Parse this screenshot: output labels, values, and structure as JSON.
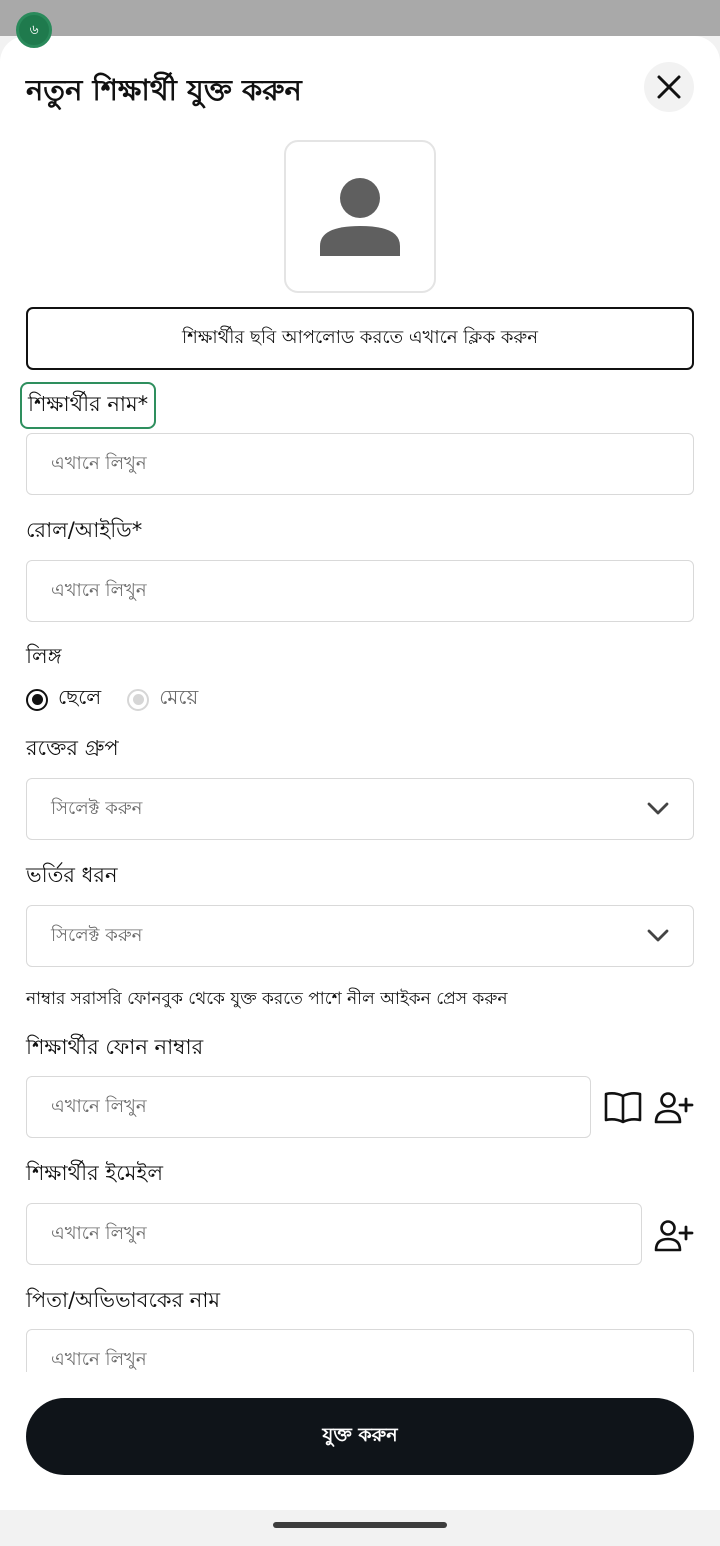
{
  "status_badge": "৬",
  "sheet": {
    "title": "নতুন শিক্ষার্থী যুক্ত করুন",
    "upload_label": "শিক্ষার্থীর ছবি আপলোড করতে এখানে ক্লিক করুন"
  },
  "form": {
    "name": {
      "label": "শিক্ষার্থীর নাম*",
      "placeholder": "এখানে লিখুন"
    },
    "roll": {
      "label": "রোল/আইডি*",
      "placeholder": "এখানে লিখুন"
    },
    "gender": {
      "label": "লিঙ্গ",
      "options": [
        {
          "label": "ছেলে",
          "selected": true
        },
        {
          "label": "মেয়ে",
          "selected": false
        }
      ]
    },
    "blood_group": {
      "label": "রক্তের গ্রুপ",
      "placeholder": "সিলেক্ট করুন"
    },
    "admission_type": {
      "label": "ভর্তির ধরন",
      "placeholder": "সিলেক্ট করুন"
    },
    "phonebook_hint": "নাম্বার সরাসরি ফোনবুক থেকে যুক্ত করতে পাশে নীল আইকন প্রেস করুন",
    "phone": {
      "label": "শিক্ষার্থীর ফোন নাম্বার",
      "placeholder": "এখানে লিখুন"
    },
    "email": {
      "label": "শিক্ষার্থীর ইমেইল",
      "placeholder": "এখানে লিখুন"
    },
    "guardian": {
      "label": "পিতা/অভিভাবকের নাম",
      "placeholder": "এখানে লিখুন"
    }
  },
  "submit_label": "যুক্ত করুন",
  "icons": {
    "close": "close-icon",
    "avatar": "person-placeholder-icon",
    "dropdown": "chevron-down-icon",
    "phonebook": "book-icon",
    "add_contact": "person-add-icon"
  },
  "colors": {
    "accent_green": "#1f7a4d",
    "focus_outline": "#2e8f5e",
    "button_dark": "#0f1419"
  }
}
